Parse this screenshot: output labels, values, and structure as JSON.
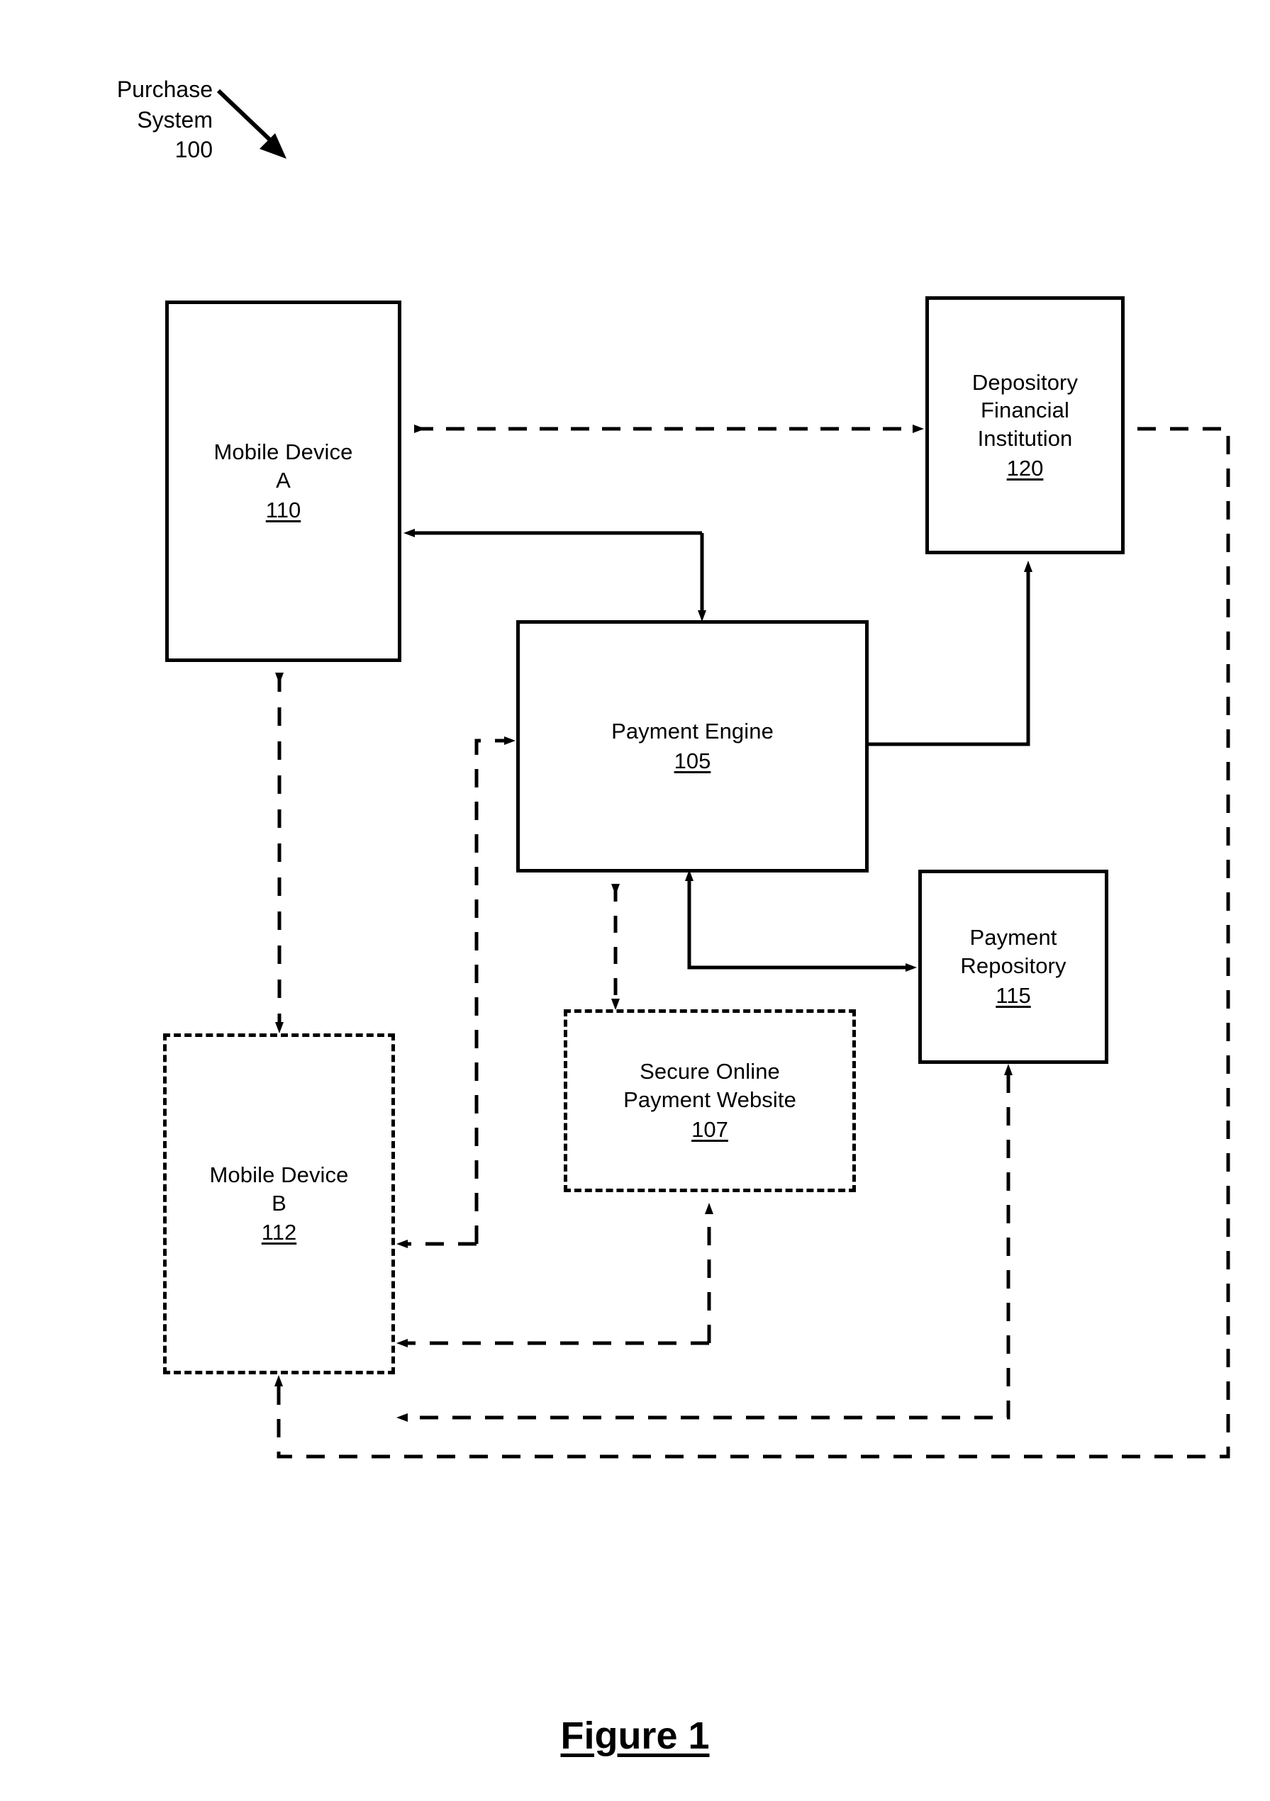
{
  "figure": {
    "caption": "Figure 1"
  },
  "callout": {
    "line1": "Purchase",
    "line2": "System",
    "line3": "100",
    "arrow_icon": "diagonal-arrow-icon"
  },
  "nodes": [
    {
      "id": "mobile-device-a",
      "line1": "Mobile Device",
      "line2": "A",
      "ref": "110",
      "border": "solid"
    },
    {
      "id": "depository-financial-institution",
      "line1": "Depository",
      "line2": "Financial",
      "line3": "Institution",
      "ref": "120",
      "border": "solid"
    },
    {
      "id": "payment-engine",
      "line1": "Payment Engine",
      "ref": "105",
      "border": "solid"
    },
    {
      "id": "payment-repository",
      "line1": "Payment",
      "line2": "Repository",
      "ref": "115",
      "border": "solid"
    },
    {
      "id": "secure-online-payment-website",
      "line1": "Secure Online",
      "line2": "Payment Website",
      "ref": "107",
      "border": "dashed"
    },
    {
      "id": "mobile-device-b",
      "line1": "Mobile Device",
      "line2": "B",
      "ref": "112",
      "border": "dashed"
    }
  ],
  "connectors": [
    {
      "id": "mobile-a-to-dfi",
      "style": "dashed",
      "heads": "both",
      "from": "mobile-device-a",
      "to": "depository-financial-institution"
    },
    {
      "id": "engine-to-mobile-a",
      "style": "solid",
      "heads": "single",
      "from": "payment-engine",
      "to": "mobile-device-a"
    },
    {
      "id": "mobile-a-branch-to-engine",
      "style": "solid",
      "heads": "single",
      "from": "mobile-device-a",
      "to": "payment-engine"
    },
    {
      "id": "engine-to-dfi",
      "style": "solid",
      "heads": "single",
      "from": "payment-engine",
      "to": "depository-financial-institution"
    },
    {
      "id": "engine-to-repository",
      "style": "solid",
      "heads": "single",
      "from": "payment-engine",
      "to": "payment-repository"
    },
    {
      "id": "engine-to-website",
      "style": "dashed",
      "heads": "both",
      "from": "payment-engine",
      "to": "secure-online-payment-website"
    },
    {
      "id": "mobile-a-to-mobile-b",
      "style": "dashed",
      "heads": "both",
      "from": "mobile-device-a",
      "to": "mobile-device-b"
    },
    {
      "id": "mobile-b-to-engine",
      "style": "dashed",
      "heads": "single",
      "from": "mobile-device-b",
      "to": "payment-engine"
    },
    {
      "id": "website-to-mobile-b",
      "style": "dashed",
      "heads": "single",
      "from": "secure-online-payment-website",
      "to": "mobile-device-b"
    },
    {
      "id": "repository-to-mobile-b",
      "style": "dashed",
      "heads": "single",
      "from": "payment-repository",
      "to": "mobile-device-b"
    },
    {
      "id": "dfi-to-mobile-b",
      "style": "dashed",
      "heads": "single",
      "from": "depository-financial-institution",
      "to": "mobile-device-b"
    },
    {
      "id": "repository-from-website",
      "style": "dashed",
      "heads": "single",
      "from": "mobile-device-b",
      "to": "secure-online-payment-website"
    }
  ],
  "colors": {
    "ink": "#000000",
    "paper": "#ffffff"
  }
}
